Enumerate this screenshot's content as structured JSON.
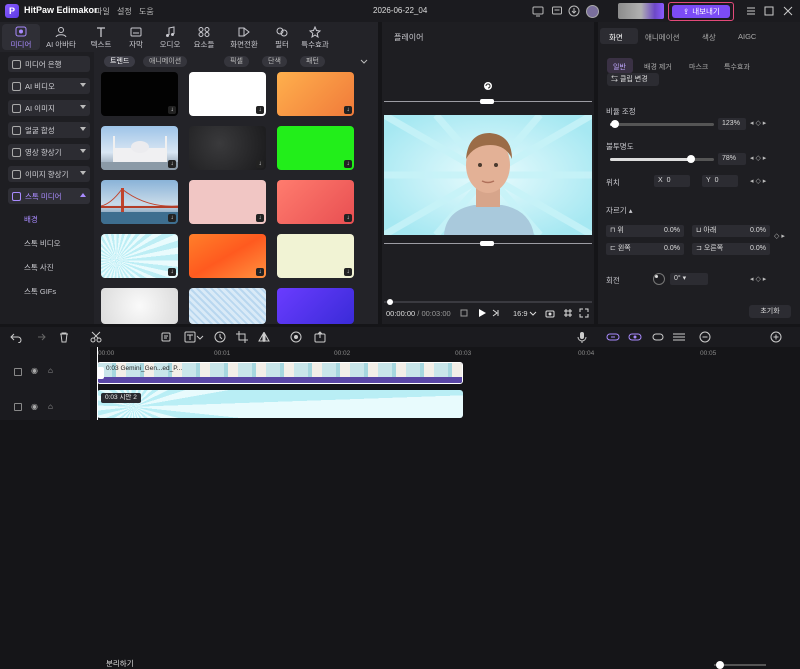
{
  "app": {
    "title": "HitPaw Edimakor",
    "menu": [
      "파일",
      "설정",
      "도움"
    ],
    "project": "2026-06-22_04",
    "export_label": "내보내기"
  },
  "categories": [
    {
      "label": "미디어",
      "icon": "media-icon",
      "active": true
    },
    {
      "label": "AI 아바타",
      "icon": "ai-avatar-icon"
    },
    {
      "label": "텍스트",
      "icon": "text-icon"
    },
    {
      "label": "자막",
      "icon": "subtitle-icon"
    },
    {
      "label": "오디오",
      "icon": "audio-icon"
    },
    {
      "label": "요소들",
      "icon": "elements-icon"
    },
    {
      "label": "화면전환",
      "icon": "transition-icon"
    },
    {
      "label": "필터",
      "icon": "filter-icon"
    },
    {
      "label": "특수효과",
      "icon": "effects-icon"
    }
  ],
  "sidenav": [
    {
      "label": "미디어 은행"
    },
    {
      "label": "AI 비디오"
    },
    {
      "label": "AI 이미지"
    },
    {
      "label": "얼굴 합성"
    },
    {
      "label": "영상 향상기"
    },
    {
      "label": "이미지 향상기"
    },
    {
      "label": "스톡 미디어",
      "active": true
    }
  ],
  "stock_sub": [
    "배경",
    "스톡 비디오",
    "스톡 사진",
    "스톡 GIFs"
  ],
  "filter_chips": [
    "트렌드",
    "애니메이션",
    "픽셀",
    "단색",
    "패턴"
  ],
  "player": {
    "label": "플레이어",
    "time_current": "00:00:00",
    "time_total": "/ 00:03:00",
    "ratio": "16:9"
  },
  "properties": {
    "tabs": [
      "화면",
      "애니메이션",
      "색상",
      "AIGC"
    ],
    "subtabs": [
      "일반",
      "배경 제거",
      "마스크",
      "특수효과"
    ],
    "clip_change": "클립 변경",
    "scale_label": "비율 조정",
    "scale_value": "123",
    "scale_unit": "%",
    "scale_fraction": 0.05,
    "opacity_label": "불투명도",
    "opacity_value": "78",
    "opacity_unit": "%",
    "opacity_fraction": 0.78,
    "position_label": "위치",
    "x_label": "X",
    "x_value": "0",
    "y_label": "Y",
    "y_value": "0",
    "crop_label": "자르기",
    "crop": [
      {
        "label": "위",
        "value": "0.0%"
      },
      {
        "label": "아래",
        "value": "0.0%"
      },
      {
        "label": "왼쪽",
        "value": "0.0%"
      },
      {
        "label": "오른쪽",
        "value": "0.0%"
      }
    ],
    "rotate_label": "회전",
    "rotate_value": "0",
    "rotate_unit": "°",
    "reset_label": "초기화"
  },
  "toolbar": {
    "split_label": "분리하기"
  },
  "timeline": {
    "ruler": [
      "00:00",
      "00:01",
      "00:02",
      "00:03",
      "00:04",
      "00:05"
    ],
    "clip1_label": "0:03 Gemini_Gen...ed_P...",
    "clip2_label": "0:03 시안 2"
  }
}
